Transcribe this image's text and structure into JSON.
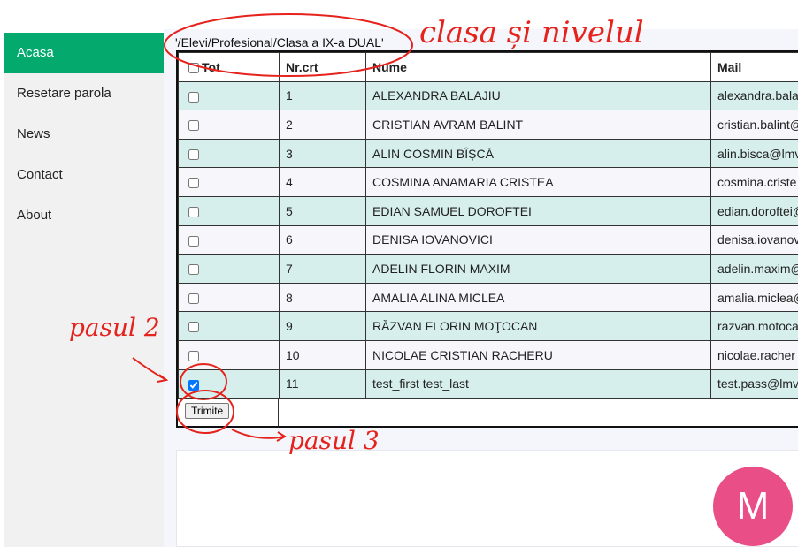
{
  "sidebar": {
    "items": [
      {
        "label": "Acasa",
        "active": true
      },
      {
        "label": "Resetare parola",
        "active": false
      },
      {
        "label": "News",
        "active": false
      },
      {
        "label": "Contact",
        "active": false
      },
      {
        "label": "About",
        "active": false
      }
    ],
    "accent_color": "#04aa6d"
  },
  "breadcrumb": "'/Elevi/Profesional/Clasa a IX-a DUAL'",
  "table": {
    "headers": {
      "select_all": "Tot",
      "number": "Nr.crt",
      "name": "Nume",
      "mail": "Mail"
    },
    "rows": [
      {
        "nr": "1",
        "name": "ALEXANDRA BALAJIU",
        "mail": "alexandra.bala",
        "checked": false
      },
      {
        "nr": "2",
        "name": "CRISTIAN AVRAM BALINT",
        "mail": "cristian.balint@",
        "checked": false
      },
      {
        "nr": "3",
        "name": "ALIN COSMIN BÎȘCĂ",
        "mail": "alin.bisca@lmv",
        "checked": false
      },
      {
        "nr": "4",
        "name": "COSMINA ANAMARIA CRISTEA",
        "mail": "cosmina.criste",
        "checked": false
      },
      {
        "nr": "5",
        "name": "EDIAN SAMUEL DOROFTEI",
        "mail": "edian.doroftei@",
        "checked": false
      },
      {
        "nr": "6",
        "name": "DENISA IOVANOVICI",
        "mail": "denisa.iovanov",
        "checked": false
      },
      {
        "nr": "7",
        "name": "ADELIN FLORIN MAXIM",
        "mail": "adelin.maxim@",
        "checked": false
      },
      {
        "nr": "8",
        "name": "AMALIA ALINA MICLEA",
        "mail": "amalia.miclea@",
        "checked": false
      },
      {
        "nr": "9",
        "name": "RĂZVAN FLORIN MOŢOCAN",
        "mail": "razvan.motoca",
        "checked": false
      },
      {
        "nr": "10",
        "name": "NICOLAE CRISTIAN RACHERU",
        "mail": "nicolae.racher",
        "checked": false
      },
      {
        "nr": "11",
        "name": "test_first test_last",
        "mail": "test.pass@lmv",
        "checked": true
      }
    ],
    "row_colors": {
      "odd": "#d6efed",
      "even": "#f6f6fb"
    }
  },
  "submit_label": "Trimite",
  "avatar": {
    "letter": "M",
    "color": "#e94e86"
  },
  "annotations": {
    "class_note": "clasa și nivelul",
    "step2": "pasul 2",
    "step3": "pasul 3",
    "color": "#e5221c"
  }
}
